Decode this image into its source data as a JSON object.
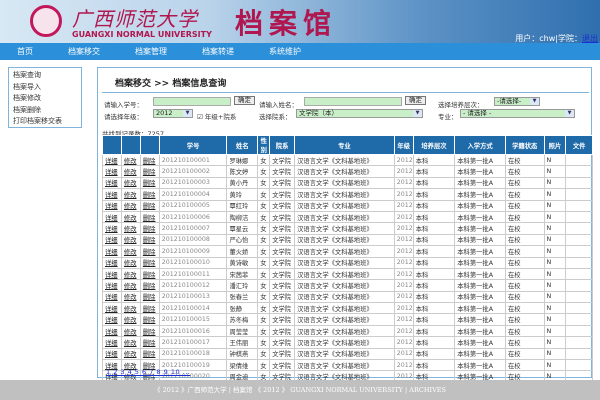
{
  "header": {
    "university_cn": "广西师范大学",
    "university_en": "GUANGXI NORMAL UNIVERSITY",
    "system": "档案馆",
    "user_text": "用户：chw|学院：",
    "logout": "退出"
  },
  "nav": [
    "首页",
    "档案移交",
    "档案管理",
    "档案转递",
    "系统维护"
  ],
  "sidebar": [
    "档案查询",
    "档案导入",
    "档案修改",
    "档案删除",
    "打印档案移交表"
  ],
  "breadcrumb": "档案移交 >> 档案信息查询",
  "filters": {
    "student_no_label": "请输入学号：",
    "confirm": "确定",
    "name_label": "请输入姓名：",
    "level_label": "选择培养层次：",
    "level_value": "-请选择-",
    "grade_label": "请选择年级：",
    "grade_value": "2012",
    "grade_college_check": "年级+院系",
    "college_label": "选择院系：",
    "college_value": "文学院（本）",
    "major_label": "专业：",
    "major_value": "- 请选择 -"
  },
  "count_label": "共找到记录数：",
  "count": "7257",
  "table": {
    "headers": [
      "",
      "",
      "",
      "学号",
      "姓名",
      "性别",
      "院系",
      "专业",
      "年级",
      "培养层次",
      "入学方式",
      "学籍状态",
      "照片",
      "文件"
    ],
    "actions": [
      "详细",
      "修改",
      "删除"
    ],
    "rows": [
      [
        "201210100001",
        "罗琳娜",
        "女",
        "文学院",
        "汉语言文学《文科基地班》",
        "2012",
        "本科",
        "本科第一批A",
        "在校",
        "N",
        ""
      ],
      [
        "201210100002",
        "陈文婷",
        "女",
        "文学院",
        "汉语言文学《文科基地班》",
        "2012",
        "本科",
        "本科第一批A",
        "在校",
        "N",
        ""
      ],
      [
        "201210100003",
        "黄小丹",
        "女",
        "文学院",
        "汉语言文学《文科基地班》",
        "2012",
        "本科",
        "本科第一批A",
        "在校",
        "N",
        ""
      ],
      [
        "201210100004",
        "黄玲",
        "女",
        "文学院",
        "汉语言文学《文科基地班》",
        "2012",
        "本科",
        "本科第一批A",
        "在校",
        "N",
        ""
      ],
      [
        "201210100005",
        "覃红玲",
        "女",
        "文学院",
        "汉语言文学《文科基地班》",
        "2012",
        "本科",
        "本科第一批A",
        "在校",
        "N",
        ""
      ],
      [
        "201210100006",
        "陶柳洁",
        "女",
        "文学院",
        "汉语言文学《文科基地班》",
        "2012",
        "本科",
        "本科第一批A",
        "在校",
        "N",
        ""
      ],
      [
        "201210100007",
        "覃星云",
        "女",
        "文学院",
        "汉语言文学《文科基地班》",
        "2012",
        "本科",
        "本科第一批A",
        "在校",
        "N",
        ""
      ],
      [
        "201210100008",
        "严心怡",
        "女",
        "文学院",
        "汉语言文学《文科基地班》",
        "2012",
        "本科",
        "本科第一批A",
        "在校",
        "N",
        ""
      ],
      [
        "201210100009",
        "董火娇",
        "女",
        "文学院",
        "汉语言文学《文科基地班》",
        "2012",
        "本科",
        "本科第一批A",
        "在校",
        "N",
        ""
      ],
      [
        "201210100010",
        "黄诗敏",
        "女",
        "文学院",
        "汉语言文学《文科基地班》",
        "2012",
        "本科",
        "本科第一批A",
        "在校",
        "N",
        ""
      ],
      [
        "201210100011",
        "宋茜菲",
        "女",
        "文学院",
        "汉语言文学《文科基地班》",
        "2012",
        "本科",
        "本科第一批A",
        "在校",
        "N",
        ""
      ],
      [
        "201210100012",
        "潘汇玲",
        "女",
        "文学院",
        "汉语言文学《文科基地班》",
        "2012",
        "本科",
        "本科第一批A",
        "在校",
        "N",
        ""
      ],
      [
        "201210100013",
        "张春兰",
        "女",
        "文学院",
        "汉语言文学《文科基地班》",
        "2012",
        "本科",
        "本科第一批A",
        "在校",
        "N",
        ""
      ],
      [
        "201210100014",
        "张静",
        "女",
        "文学院",
        "汉语言文学《文科基地班》",
        "2012",
        "本科",
        "本科第一批A",
        "在校",
        "N",
        ""
      ],
      [
        "201210100015",
        "苏冬梅",
        "女",
        "文学院",
        "汉语言文学《文科基地班》",
        "2012",
        "本科",
        "本科第一批A",
        "在校",
        "N",
        ""
      ],
      [
        "201210100016",
        "周莹莹",
        "女",
        "文学院",
        "汉语言文学《文科基地班》",
        "2012",
        "本科",
        "本科第一批A",
        "在校",
        "N",
        ""
      ],
      [
        "201210100017",
        "王伟丽",
        "女",
        "文学院",
        "汉语言文学《文科基地班》",
        "2012",
        "本科",
        "本科第一批A",
        "在校",
        "N",
        ""
      ],
      [
        "201210100018",
        "钟棋燕",
        "女",
        "文学院",
        "汉语言文学《文科基地班》",
        "2012",
        "本科",
        "本科第一批A",
        "在校",
        "N",
        ""
      ],
      [
        "201210100019",
        "梁倩维",
        "女",
        "文学院",
        "汉语言文学《文科基地班》",
        "2012",
        "本科",
        "本科第一批A",
        "在校",
        "N",
        ""
      ],
      [
        "201210100020",
        "周金迪",
        "女",
        "文学院",
        "汉语言文学《文科基地班》",
        "2012",
        "本科",
        "本科第一批A",
        "在校",
        "N",
        ""
      ]
    ]
  },
  "pager": "1 2 3 4 5 6 7 8 9 10 ...",
  "footer": "《 2012 》广西师范大学 | 档案馆 《 2012 》 GUANGXI NORMAL UNIVERSITY | ARCHIVES"
}
